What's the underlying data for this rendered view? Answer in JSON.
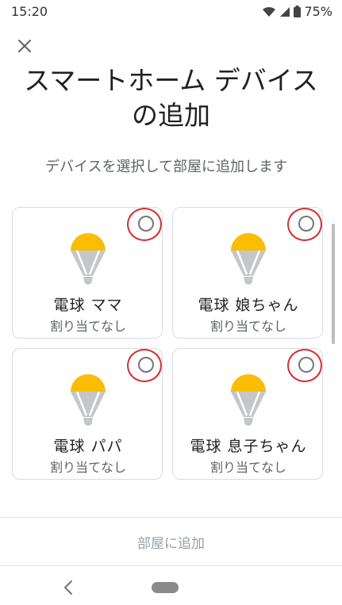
{
  "status_bar": {
    "time": "15:20",
    "battery": "75%",
    "icons": [
      "wifi-icon",
      "signal-icon",
      "battery-icon"
    ]
  },
  "header": {
    "close_icon": "close-icon",
    "title_line1": "スマートホーム デバイス",
    "title_line2": "の追加",
    "subtitle": "デバイスを選択して部屋に追加します"
  },
  "devices": [
    {
      "name": "電球 ママ",
      "status": "割り当てなし"
    },
    {
      "name": "電球 娘ちゃん",
      "status": "割り当てなし"
    },
    {
      "name": "電球 パパ",
      "status": "割り当てなし"
    },
    {
      "name": "電球 息子ちゃん",
      "status": "割り当てなし"
    }
  ],
  "footer": {
    "add_button": "部屋に追加"
  },
  "colors": {
    "bulb_top": "#fbbc04",
    "bulb_body": "#c4c7c9",
    "radio_highlight": "#d32f2f",
    "disabled_text": "#9aa0a6"
  }
}
